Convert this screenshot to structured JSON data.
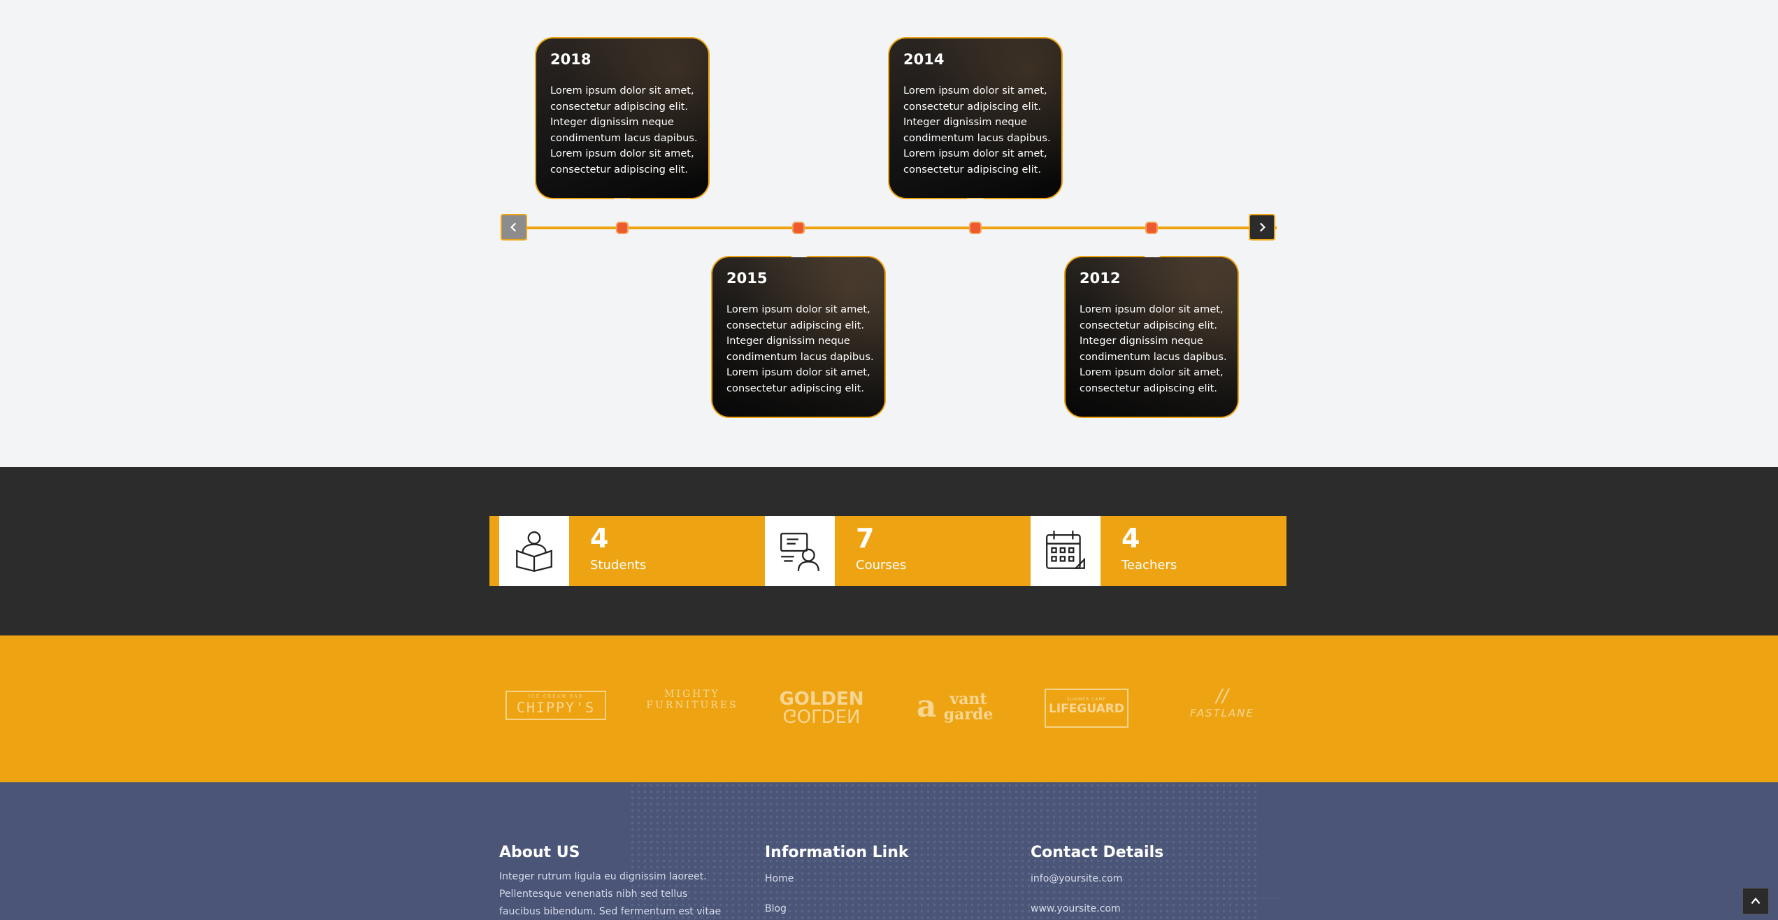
{
  "timeline": {
    "cards": [
      {
        "year": "2018",
        "text": "Lorem ipsum dolor sit amet, consectetur adipiscing elit. Integer dignissim neque condimentum lacus dapibus. Lorem ipsum dolor sit amet, consectetur adipiscing elit."
      },
      {
        "year": "2015",
        "text": "Lorem ipsum dolor sit amet, consectetur adipiscing elit. Integer dignissim neque condimentum lacus dapibus. Lorem ipsum dolor sit amet, consectetur adipiscing elit."
      },
      {
        "year": "2014",
        "text": "Lorem ipsum dolor sit amet, consectetur adipiscing elit. Integer dignissim neque condimentum lacus dapibus. Lorem ipsum dolor sit amet, consectetur adipiscing elit."
      },
      {
        "year": "2012",
        "text": "Lorem ipsum dolor sit amet, consectetur adipiscing elit. Integer dignissim neque condimentum lacus dapibus. Lorem ipsum dolor sit amet, consectetur adipiscing elit."
      }
    ],
    "prev_icon": "chevron-left-icon",
    "next_icon": "chevron-right-icon",
    "accent_color": "#eea412",
    "dot_color": "#ee5a2e"
  },
  "stats": [
    {
      "number": "4",
      "label": "Students",
      "icon": "student-reading-icon"
    },
    {
      "number": "7",
      "label": "Courses",
      "icon": "online-teacher-icon"
    },
    {
      "number": "4",
      "label": "Teachers",
      "icon": "calendar-icon"
    }
  ],
  "partners": {
    "logos": [
      {
        "small": "ICE CREAM BAR",
        "name": "CHIPPY'S"
      },
      {
        "small": "MIGHTY",
        "name": "FURNITURES"
      },
      {
        "small": "GOLDEN",
        "name": "GOLDEN"
      },
      {
        "small": "a",
        "name": "vant garde"
      },
      {
        "small": "SUMMER CAMP",
        "name": "LIFEGUARD"
      },
      {
        "small": "",
        "name": "FASTLANE"
      }
    ]
  },
  "footer": {
    "about": {
      "title": "About US",
      "text": "Integer rutrum ligula eu dignissim laoreet. Pellentesque venenatis nibh sed tellus faucibus bibendum. Sed fermentum est vitae rhoncus"
    },
    "links": {
      "title": "Information Link",
      "items": [
        "Home",
        "Blog"
      ]
    },
    "contact": {
      "title": "Contact Details",
      "items": [
        "info@yoursite.com",
        "www.yoursite.com"
      ]
    }
  },
  "colors": {
    "dark_band": "#2c2c2c",
    "orange_band": "#eea412",
    "footer": "#4a5577"
  }
}
